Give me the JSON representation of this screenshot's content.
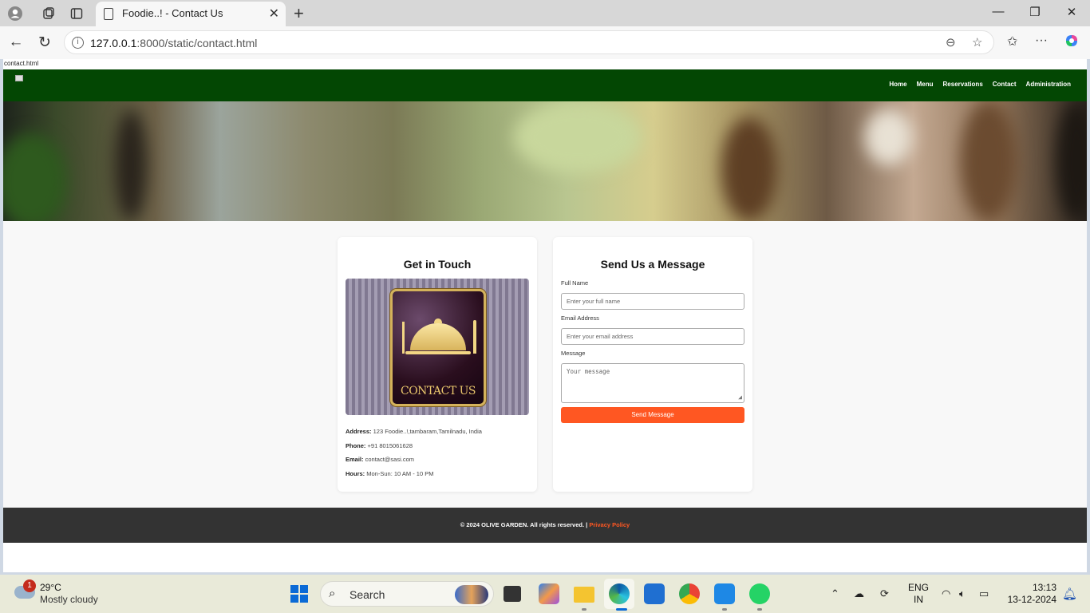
{
  "browser": {
    "tab_title": "Foodie..! - Contact Us",
    "url_host": "127.0.0.1",
    "url_rest": ":8000/static/contact.html",
    "status_label": "contact.html"
  },
  "site": {
    "nav": [
      "Home",
      "Menu",
      "Reservations",
      "Contact",
      "Administration"
    ],
    "get_in_touch": {
      "title": "Get in Touch",
      "image_text": "CONTACT US",
      "address_label": "Address:",
      "address": "123 Foodie..!,tambaram,Tamilnadu, India",
      "phone_label": "Phone:",
      "phone": "+91 8015061628",
      "email_label": "Email:",
      "email": "contact@sasi.com",
      "hours_label": "Hours:",
      "hours": "Mon-Sun: 10 AM - 10 PM"
    },
    "form": {
      "title": "Send Us a Message",
      "name_label": "Full Name",
      "name_placeholder": "Enter your full name",
      "email_label": "Email Address",
      "email_placeholder": "Enter your email address",
      "message_label": "Message",
      "message_placeholder": "Your message",
      "submit": "Send Message"
    },
    "footer": {
      "text": "© 2024 OLIVE GARDEN. All rights reserved. | ",
      "link": "Privacy Policy"
    }
  },
  "taskbar": {
    "weather_badge": "1",
    "temperature": "29°C",
    "weather_desc": "Mostly cloudy",
    "search": "Search",
    "lang_1": "ENG",
    "lang_2": "IN",
    "time": "13:13",
    "date": "13-12-2024"
  },
  "colors": {
    "nav_green": "#034703",
    "accent": "#ff5722",
    "footer": "#333333"
  }
}
